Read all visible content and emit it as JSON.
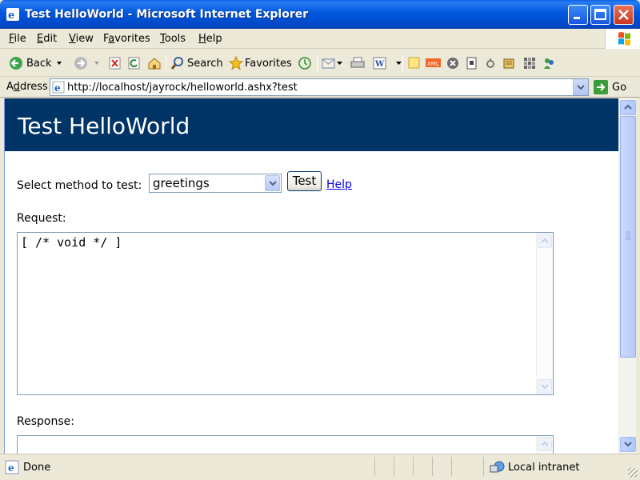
{
  "window": {
    "title": "Test HelloWorld - Microsoft Internet Explorer"
  },
  "menu": [
    {
      "label": "File",
      "key": "F",
      "rest": "ile"
    },
    {
      "label": "Edit",
      "key": "E",
      "rest": "dit"
    },
    {
      "label": "View",
      "key": "V",
      "rest": "iew"
    },
    {
      "label": "Favorites",
      "key": "a",
      "pre": "F",
      "rest": "vorites"
    },
    {
      "label": "Tools",
      "key": "T",
      "rest": "ools"
    },
    {
      "label": "Help",
      "key": "H",
      "rest": "elp"
    }
  ],
  "toolbar": {
    "back_label": "Back",
    "search_label": "Search",
    "favorites_label": "Favorites"
  },
  "address": {
    "label_key": "d",
    "label_pre": "A",
    "label_rest": "dress",
    "url": "http://localhost/jayrock/helloworld.ashx?test",
    "go_label": "Go"
  },
  "page": {
    "title": "Test HelloWorld",
    "select_label": "Select method to test:",
    "selected_method": "greetings",
    "test_button": "Test",
    "help_link": "Help",
    "request_label": "Request:",
    "request_value": "[ /* void */ ]",
    "response_label": "Response:",
    "response_value": ""
  },
  "status": {
    "text": "Done",
    "zone": "Local intranet"
  },
  "colors": {
    "header_bg": "#003366",
    "title_bar": "#0054e3"
  }
}
